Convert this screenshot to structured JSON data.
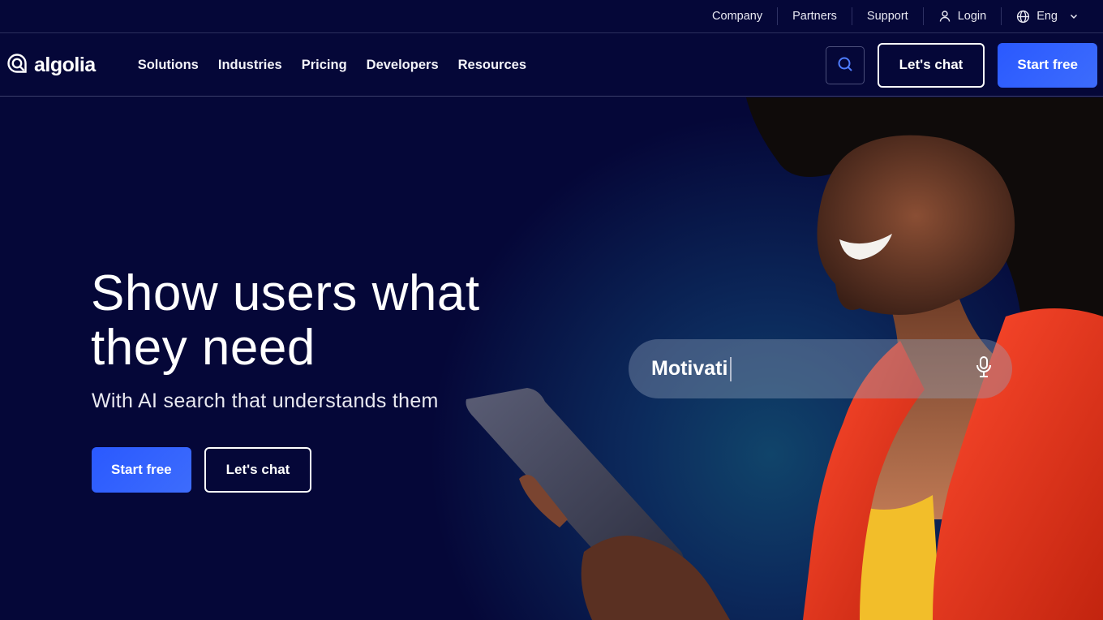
{
  "topbar": {
    "items": [
      {
        "label": "Company"
      },
      {
        "label": "Partners"
      },
      {
        "label": "Support"
      },
      {
        "label": "Login",
        "icon": "user-icon"
      },
      {
        "label": "Eng",
        "icon": "globe-icon",
        "trailing_icon": "chevron-down-icon"
      }
    ]
  },
  "navbar": {
    "logo_text": "algolia",
    "links": [
      {
        "label": "Solutions"
      },
      {
        "label": "Industries"
      },
      {
        "label": "Pricing"
      },
      {
        "label": "Developers"
      },
      {
        "label": "Resources"
      }
    ],
    "search_icon": "search-icon",
    "chat_label": "Let's chat",
    "start_label": "Start free"
  },
  "hero": {
    "title_line1": "Show users what",
    "title_line2": "they need",
    "subtitle": "With AI search that understands them",
    "primary_cta": "Start free",
    "secondary_cta": "Let's chat",
    "demo_search": {
      "query": "Motivati",
      "icon": "microphone-icon"
    }
  },
  "colors": {
    "background": "#050738",
    "primary": "#2a59ff",
    "jacket": "#e0351f",
    "top": "#f2be2a"
  }
}
